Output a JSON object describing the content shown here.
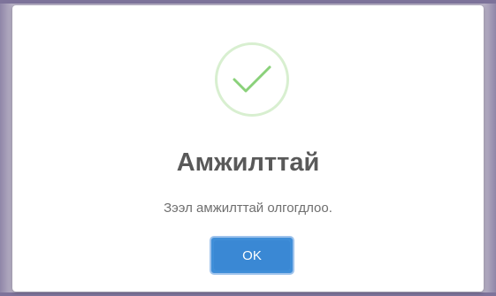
{
  "dialog": {
    "icon": "success-check-icon",
    "title": "Амжилттай",
    "message": "Зээл амжилттай олгогдлоо.",
    "ok_label": "OK"
  },
  "colors": {
    "check_stroke": "#8ad17a",
    "check_ring": "#d8efd0",
    "title_text": "#595959",
    "message_text": "#6f6f6f",
    "button_bg": "#3f8ed8",
    "button_ring": "#9fc3ec"
  }
}
